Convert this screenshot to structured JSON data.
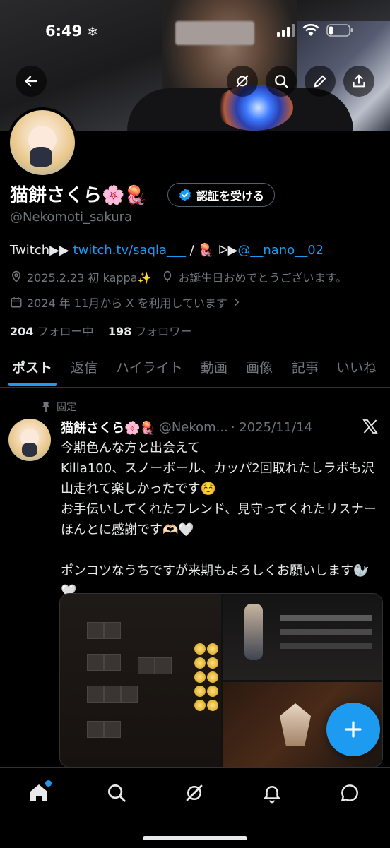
{
  "status_bar": {
    "time": "6:49"
  },
  "profile": {
    "name": "猫餅さくら🌸🪼",
    "verify_label": "認証を受ける",
    "handle": "@Nekomoti_sakura",
    "bio_prefix": "Twitch▶︎▶︎ ",
    "bio_link": "twitch.tv/saqla___",
    "bio_sep": " / 🪼 ᐅ▶︎",
    "bio_mention": "@__nano__02",
    "meta_note": "2025.2.23 初 kappa✨",
    "birthday": "お誕生日おめでとうございます。",
    "joined": "2024 年 11月から X を利用しています",
    "following_count": "204",
    "following_label": "フォロー中",
    "followers_count": "198",
    "followers_label": "フォロワー"
  },
  "tabs": [
    {
      "label": "ポスト",
      "active": true
    },
    {
      "label": "返信"
    },
    {
      "label": "ハイライト"
    },
    {
      "label": "動画"
    },
    {
      "label": "画像"
    },
    {
      "label": "記事"
    },
    {
      "label": "いいね"
    }
  ],
  "post": {
    "pinned_label": "固定",
    "author_name": "猫餅さくら🌸🪼",
    "author_handle": "@Nekom...",
    "date": "· 2025/11/14",
    "lines": [
      "今期色んな方と出会えて",
      "Killa100、スノーボール、カッパ2回取れたしラボも沢山走れて楽しかったです☺️",
      "お手伝いしてくれたフレンド、見守ってくれたリスナーほんとに感謝です🫶🏻🤍",
      "",
      "ポンコツなうちですが来期もよろしくお願いします🦭🤍"
    ]
  },
  "icons": {
    "back": "back-arrow-icon",
    "grok": "grok-icon",
    "search": "search-icon",
    "edit": "pencil-icon",
    "share": "share-icon"
  },
  "colors": {
    "accent": "#1d9bf0",
    "muted": "#71767b",
    "background": "#000000"
  }
}
